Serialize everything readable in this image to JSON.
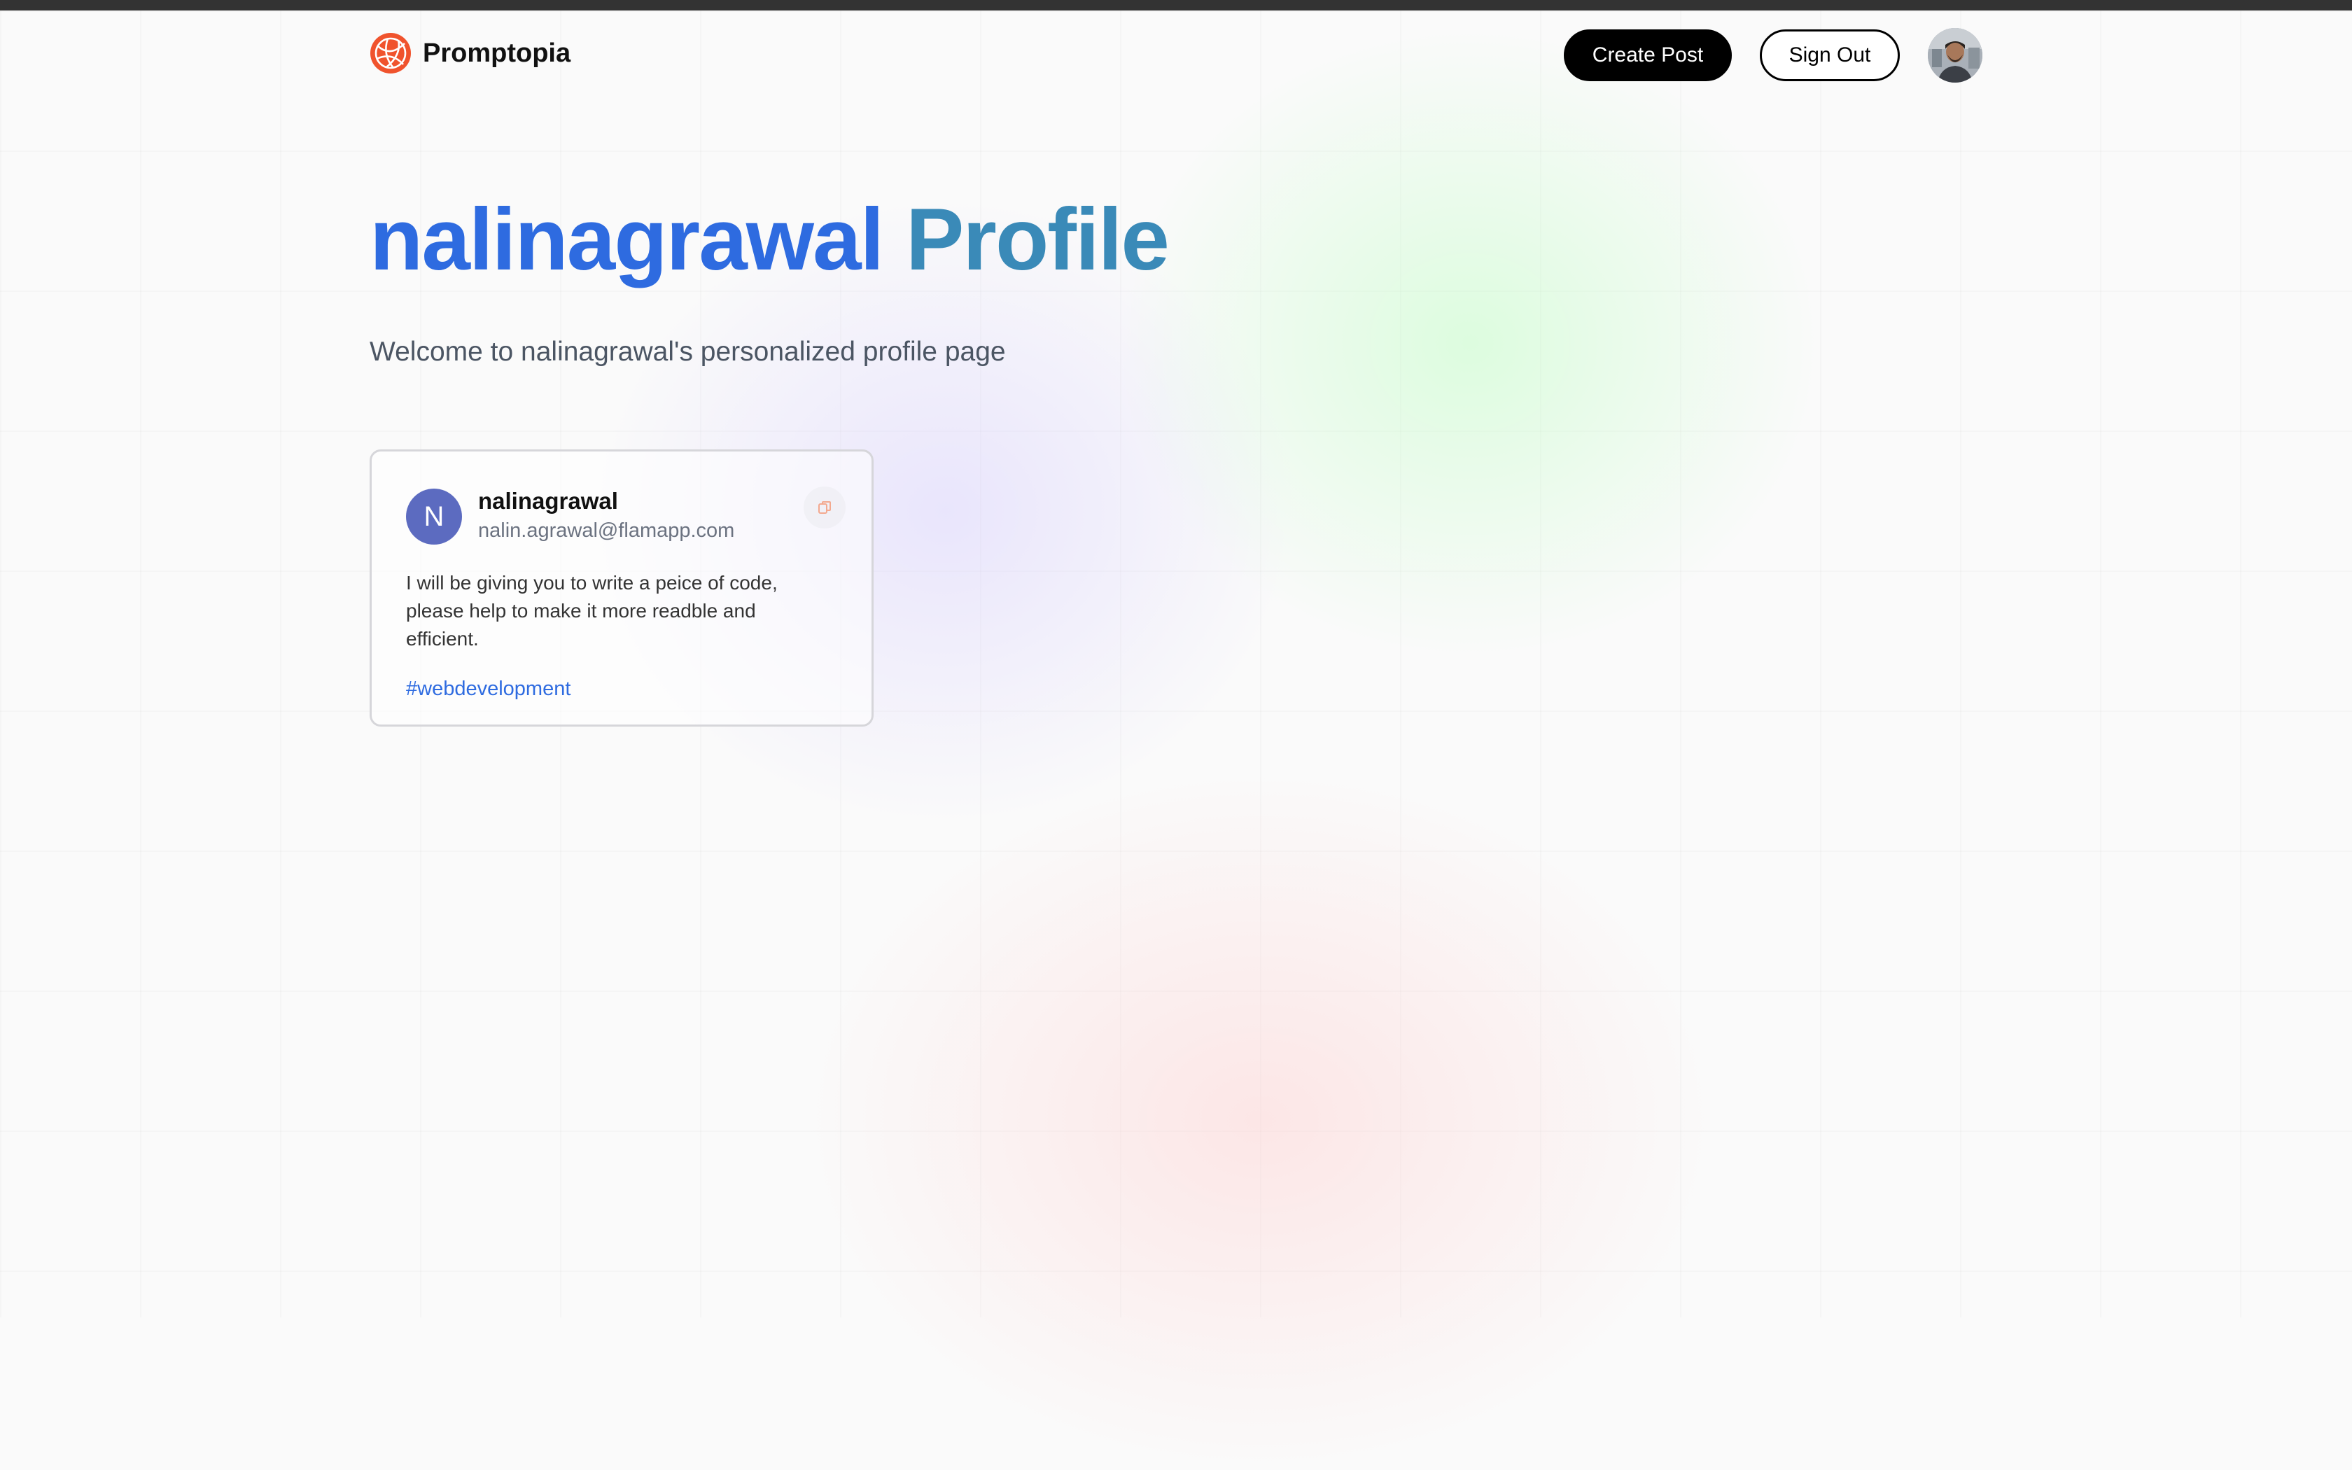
{
  "nav": {
    "brand": "Promptopia",
    "create_post": "Create Post",
    "sign_out": "Sign Out"
  },
  "profile": {
    "username": "nalinagrawal",
    "heading_suffix": "Profile",
    "description": "Welcome to nalinagrawal's personalized profile page"
  },
  "posts": [
    {
      "avatar_initial": "N",
      "username": "nalinagrawal",
      "email": "nalin.agrawal@flamapp.com",
      "prompt": "I will be giving you to write a peice of code, please help to make it more readble and efficient.",
      "tag": "#webdevelopment"
    }
  ],
  "colors": {
    "accent_blue": "#2e6be0",
    "accent_teal": "#3a8ab8",
    "logo_orange": "#f0532d",
    "avatar_purple": "#5c6bc0"
  },
  "icons": {
    "logo": "globe-logo-icon",
    "copy": "copy-icon",
    "user": "user-avatar"
  }
}
